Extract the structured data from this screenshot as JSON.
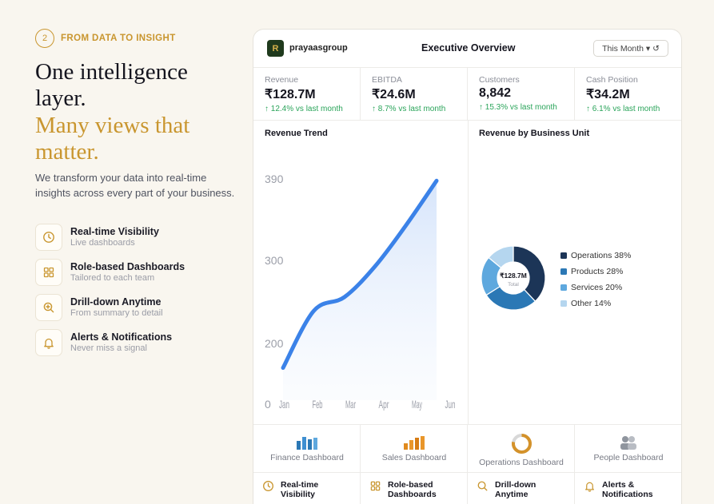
{
  "intro": {
    "step_number": "2",
    "step_label": "FROM DATA TO INSIGHT",
    "heading_line1": "One intelligence layer.",
    "heading_line2": "Many views that matter.",
    "lead": "We transform your data into real-time insights across every part of your business."
  },
  "features": [
    {
      "title": "Real-time Visibility",
      "subtitle": "Live dashboards",
      "icon": "clock-icon"
    },
    {
      "title": "Role-based Dashboards",
      "subtitle": "Tailored to each team",
      "icon": "grid-icon"
    },
    {
      "title": "Drill-down Anytime",
      "subtitle": "From summary to detail",
      "icon": "zoom-in-icon"
    },
    {
      "title": "Alerts & Notifications",
      "subtitle": "Never miss a signal",
      "icon": "bell-icon"
    }
  ],
  "dashboard": {
    "logo_letter": "R",
    "brand": "prayaasgroup",
    "title": "Executive Overview",
    "period": "This Month ▾ ↺",
    "kpis": [
      {
        "label": "Revenue",
        "value": "₹128.7M",
        "delta": "↑ 12.4% vs last month"
      },
      {
        "label": "EBITDA",
        "value": "₹24.6M",
        "delta": "↑ 8.7% vs last month"
      },
      {
        "label": "Customers",
        "value": "8,842",
        "delta": "↑ 15.3% vs last month"
      },
      {
        "label": "Cash Position",
        "value": "₹34.2M",
        "delta": "↑ 6.1% vs last month"
      }
    ],
    "trend_title": "Revenue Trend",
    "bu_title": "Revenue by Business Unit",
    "donut_center_value": "₹128.7M",
    "donut_center_label": "Total",
    "dashboards": [
      {
        "label": "Finance Dashboard",
        "icon": "bar-chart-icon"
      },
      {
        "label": "Sales Dashboard",
        "icon": "bar-chart-icon"
      },
      {
        "label": "Operations Dashboard",
        "icon": "donut-icon"
      },
      {
        "label": "People Dashboard",
        "icon": "people-icon"
      }
    ],
    "bottom_features": [
      {
        "label": "Real-time Visibility",
        "icon": "clock-icon"
      },
      {
        "label": "Role-based Dashboards",
        "icon": "grid-icon"
      },
      {
        "label": "Drill-down Anytime",
        "icon": "search-icon"
      },
      {
        "label": "Alerts & Notifications",
        "icon": "bell-icon"
      }
    ]
  },
  "colors": {
    "accent": "#c9962f",
    "line": "#3b82e8",
    "positive": "#2aa45a"
  },
  "chart_data": [
    {
      "type": "area",
      "title": "Revenue Trend",
      "categories": [
        "Jan",
        "Feb",
        "Mar",
        "Apr",
        "May",
        "Jun"
      ],
      "values": [
        175,
        245,
        262,
        300,
        350,
        405
      ],
      "y_ticks": [
        "0",
        "200",
        "300",
        "390"
      ],
      "ylim": [
        0,
        420
      ],
      "grid": false,
      "y_scale": "broken"
    },
    {
      "type": "pie",
      "title": "Revenue by Business Unit",
      "donut": true,
      "categories": [
        "Operations",
        "Products",
        "Services",
        "Other"
      ],
      "values": [
        38,
        28,
        20,
        14
      ],
      "labels": [
        "Operations 38%",
        "Products 28%",
        "Services 20%",
        "Other 14%"
      ],
      "colors": [
        "#1c3557",
        "#2b78b5",
        "#5ea8de",
        "#b5d6ef"
      ],
      "legend": "right"
    }
  ]
}
